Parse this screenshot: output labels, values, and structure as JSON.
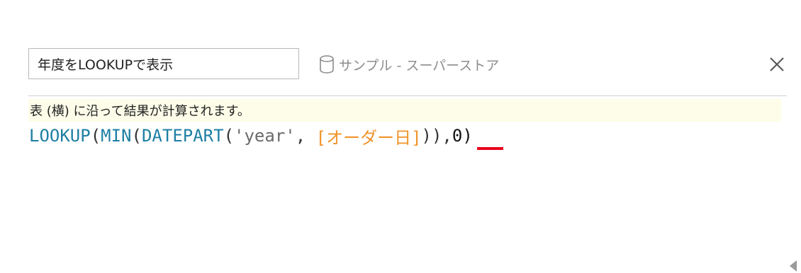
{
  "calculation": {
    "name": "年度をLOOKUPで表示",
    "datasource": "サンプル - スーパーストア",
    "datasource_icon": "database-icon",
    "close_icon": "close-icon"
  },
  "info": {
    "message": "表 (横) に沿って結果が計算されます。"
  },
  "formula": {
    "tokens": {
      "t1": "LOOKUP",
      "t2": "(",
      "t3": "MIN",
      "t4": "(",
      "t5": "DATEPART",
      "t6": "(",
      "t7": "'year'",
      "t8": ", ",
      "t9": "[オーダー日]",
      "t10": ")),",
      "t11": "0",
      "t12": ")"
    }
  },
  "colors": {
    "function": "#1e7fa3",
    "string": "#6b6b6b",
    "field": "#f0942b",
    "error_underline": "#e8001c",
    "info_background": "#fdfde9"
  }
}
